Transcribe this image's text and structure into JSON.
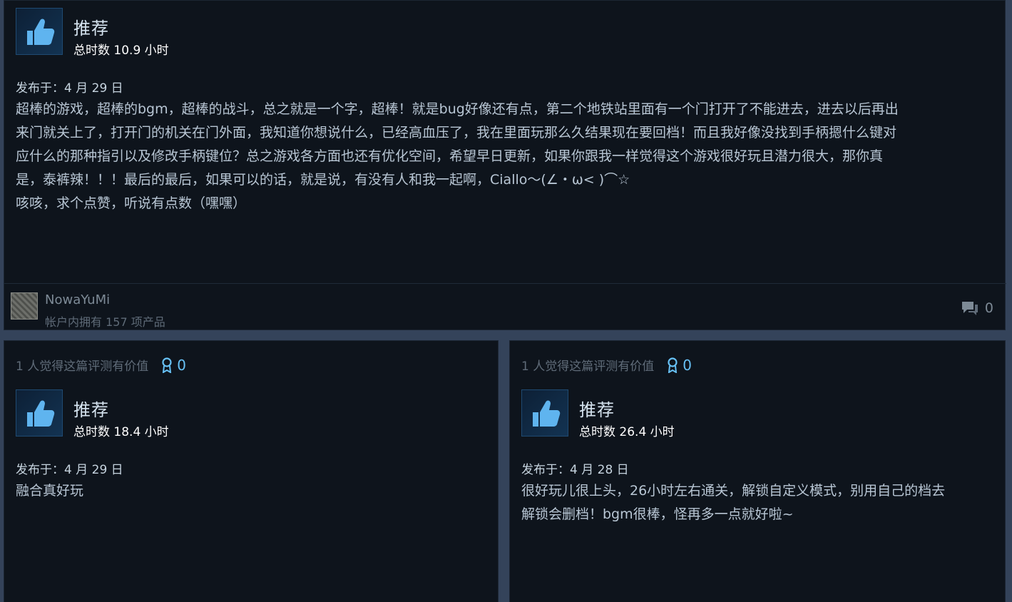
{
  "colors": {
    "accent": "#67c1f5",
    "card_bg": "#0e141c",
    "page_bg": "#34435a"
  },
  "reviews": [
    {
      "recommendation": "推荐",
      "hours": "总时数 10.9 小时",
      "posted": "发布于：4 月 29 日",
      "body_lines": [
        "超棒的游戏，超棒的bgm，超棒的战斗，总之就是一个字，超棒！就是bug好像还有点，第二个地铁站里面有一个门打开了不能进去，进去以后再出",
        "来门就关上了，打开门的机关在门外面，我知道你想说什么，已经高血压了，我在里面玩那么久结果现在要回档！而且我好像没找到手柄摁什么键对",
        "应什么的那种指引以及修改手柄键位？总之游戏各方面也还有优化空间，希望早日更新，如果你跟我一样觉得这个游戏很好玩且潜力很大，那你真",
        "是，泰裤辣！！！最后的最后，如果可以的话，就是说，有没有人和我一起啊，Ciallo～(∠・ω< )⌒☆",
        "咳咳，求个点赞，听说有点数（嘿嘿）"
      ],
      "author": {
        "name": "NowaYuMi",
        "products": "帐户内拥有 157 项产品"
      },
      "comment_count": "0",
      "thumb_icon": "thumbs-up-icon",
      "comment_icon": "comment-icon"
    },
    {
      "helpful": "1 人觉得这篇评测有价值",
      "award_count": "0",
      "recommendation": "推荐",
      "hours": "总时数 18.4 小时",
      "posted": "发布于：4 月 29 日",
      "body_lines": [
        "融合真好玩"
      ],
      "thumb_icon": "thumbs-up-icon",
      "award_icon": "award-icon"
    },
    {
      "helpful": "1 人觉得这篇评测有价值",
      "award_count": "0",
      "recommendation": "推荐",
      "hours": "总时数 26.4 小时",
      "posted": "发布于：4 月 28 日",
      "body_lines": [
        "很好玩儿很上头，26小时左右通关，解锁自定义模式，别用自己的档去",
        "解锁会删档！bgm很棒，怪再多一点就好啦~"
      ],
      "thumb_icon": "thumbs-up-icon",
      "award_icon": "award-icon"
    }
  ]
}
